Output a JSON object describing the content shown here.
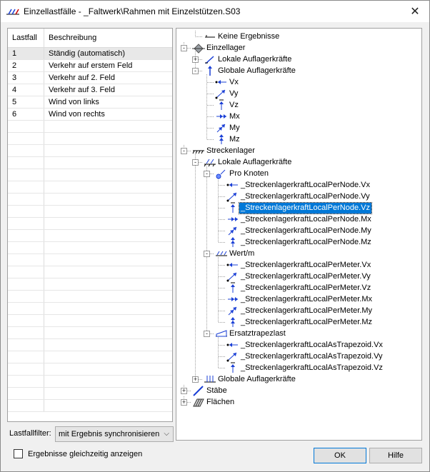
{
  "window": {
    "title": "Einzellastfälle - _Faltwerk\\Rahmen mit Einzelstützen.S03",
    "close_glyph": "✕"
  },
  "grid": {
    "headers": {
      "lastfall": "Lastfall",
      "beschreibung": "Beschreibung"
    },
    "rows": [
      {
        "id": "1",
        "desc": "Ständig (automatisch)"
      },
      {
        "id": "2",
        "desc": "Verkehr auf erstem Feld"
      },
      {
        "id": "3",
        "desc": "Verkehr auf 2. Feld"
      },
      {
        "id": "4",
        "desc": "Verkehr auf 3. Feld"
      },
      {
        "id": "5",
        "desc": "Wind von links"
      },
      {
        "id": "6",
        "desc": "Wind von rechts"
      }
    ],
    "selected_row": 0
  },
  "tree": {
    "nodes": [
      {
        "label": "Keine Ergebnisse",
        "level": 1,
        "icon": "no-result-icon"
      },
      {
        "label": "Einzellager",
        "level": 0,
        "icon": "single-support-icon",
        "expander": "-"
      },
      {
        "label": "Lokale Auflagerkräfte",
        "level": 1,
        "icon": "local-reaction-icon",
        "expander": "+"
      },
      {
        "label": "Globale Auflagerkräfte",
        "level": 1,
        "icon": "global-reaction-icon",
        "expander": "-"
      },
      {
        "label": "Vx",
        "level": 2,
        "icon": "vx-icon"
      },
      {
        "label": "Vy",
        "level": 2,
        "icon": "vy-icon"
      },
      {
        "label": "Vz",
        "level": 2,
        "icon": "vz-icon"
      },
      {
        "label": "Mx",
        "level": 2,
        "icon": "mx-icon"
      },
      {
        "label": "My",
        "level": 2,
        "icon": "my-icon"
      },
      {
        "label": "Mz",
        "level": 2,
        "icon": "mz-icon"
      },
      {
        "label": "Streckenlager",
        "level": 0,
        "icon": "line-support-icon",
        "expander": "-"
      },
      {
        "label": "Lokale Auflagerkräfte",
        "level": 1,
        "icon": "local-line-reaction-icon",
        "expander": "-"
      },
      {
        "label": "Pro Knoten",
        "level": 2,
        "icon": "per-node-icon",
        "expander": "-"
      },
      {
        "label": "_StreckenlagerkraftLocalPerNode.Vx",
        "level": 3,
        "icon": "vx-icon"
      },
      {
        "label": "_StreckenlagerkraftLocalPerNode.Vy",
        "level": 3,
        "icon": "vy-icon"
      },
      {
        "label": "_StreckenlagerkraftLocalPerNode.Vz",
        "level": 3,
        "icon": "vz-icon",
        "selected": true
      },
      {
        "label": "_StreckenlagerkraftLocalPerNode.Mx",
        "level": 3,
        "icon": "mx-icon"
      },
      {
        "label": "_StreckenlagerkraftLocalPerNode.My",
        "level": 3,
        "icon": "my-icon"
      },
      {
        "label": "_StreckenlagerkraftLocalPerNode.Mz",
        "level": 3,
        "icon": "mz-icon"
      },
      {
        "label": "Wert/m",
        "level": 2,
        "icon": "per-meter-icon",
        "expander": "-"
      },
      {
        "label": "_StreckenlagerkraftLocalPerMeter.Vx",
        "level": 3,
        "icon": "vx-icon"
      },
      {
        "label": "_StreckenlagerkraftLocalPerMeter.Vy",
        "level": 3,
        "icon": "vy-icon"
      },
      {
        "label": "_StreckenlagerkraftLocalPerMeter.Vz",
        "level": 3,
        "icon": "vz-icon"
      },
      {
        "label": "_StreckenlagerkraftLocalPerMeter.Mx",
        "level": 3,
        "icon": "mx-icon"
      },
      {
        "label": "_StreckenlagerkraftLocalPerMeter.My",
        "level": 3,
        "icon": "my-icon"
      },
      {
        "label": "_StreckenlagerkraftLocalPerMeter.Mz",
        "level": 3,
        "icon": "mz-icon"
      },
      {
        "label": "Ersatztrapezlast",
        "level": 2,
        "icon": "trapezoid-icon",
        "expander": "-"
      },
      {
        "label": "_StreckenlagerkraftLocalAsTrapezoid.Vx",
        "level": 3,
        "icon": "vx-icon"
      },
      {
        "label": "_StreckenlagerkraftLocalAsTrapezoid.Vy",
        "level": 3,
        "icon": "vy-icon"
      },
      {
        "label": "_StreckenlagerkraftLocalAsTrapezoid.Vz",
        "level": 3,
        "icon": "vz-icon"
      },
      {
        "label": "Globale Auflagerkräfte",
        "level": 1,
        "icon": "global-line-reaction-icon",
        "expander": "+"
      },
      {
        "label": "Stäbe",
        "level": 0,
        "icon": "beam-icon",
        "expander": "+"
      },
      {
        "label": "Flächen",
        "level": 0,
        "icon": "surface-icon",
        "expander": "+"
      }
    ]
  },
  "filter": {
    "label": "Lastfallfilter:",
    "value": "mit Ergebnis synchronisieren"
  },
  "checkbox": {
    "label": "Ergebnisse gleichzeitig anzeigen",
    "checked": false
  },
  "buttons": {
    "ok": "OK",
    "help": "Hilfe"
  },
  "colors": {
    "selection": "#0078d7",
    "icon_blue": "#1a3fd6"
  }
}
